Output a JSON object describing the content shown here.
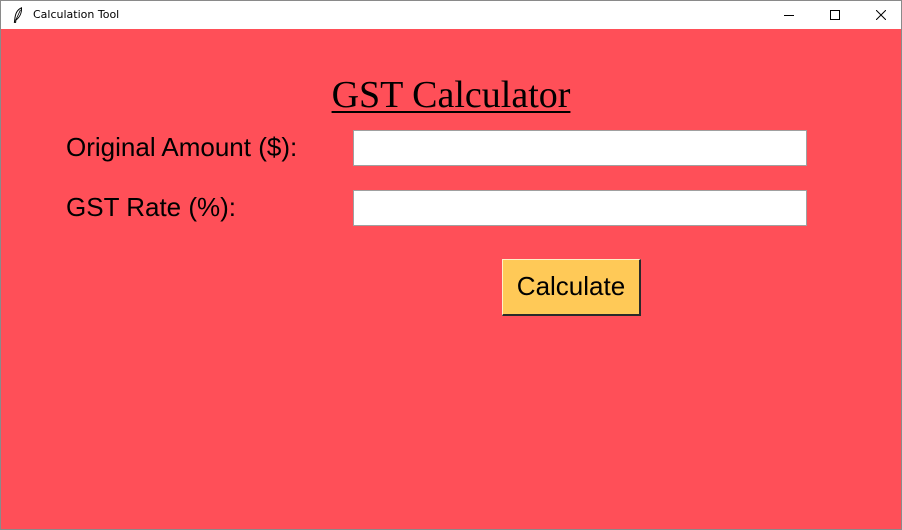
{
  "window": {
    "title": "Calculation Tool",
    "icon": "feather-icon",
    "controls": [
      "minimize-icon",
      "maximize-icon",
      "close-icon"
    ]
  },
  "form": {
    "heading": "GST Calculator",
    "fields": [
      {
        "label": "Original Amount ($):",
        "value": ""
      },
      {
        "label": "GST Rate (%):",
        "value": ""
      }
    ],
    "button_label": "Calculate"
  },
  "colors": {
    "background": "#ff4f58",
    "button": "#ffc957",
    "input_background": "#ffffff",
    "text": "#000000"
  }
}
